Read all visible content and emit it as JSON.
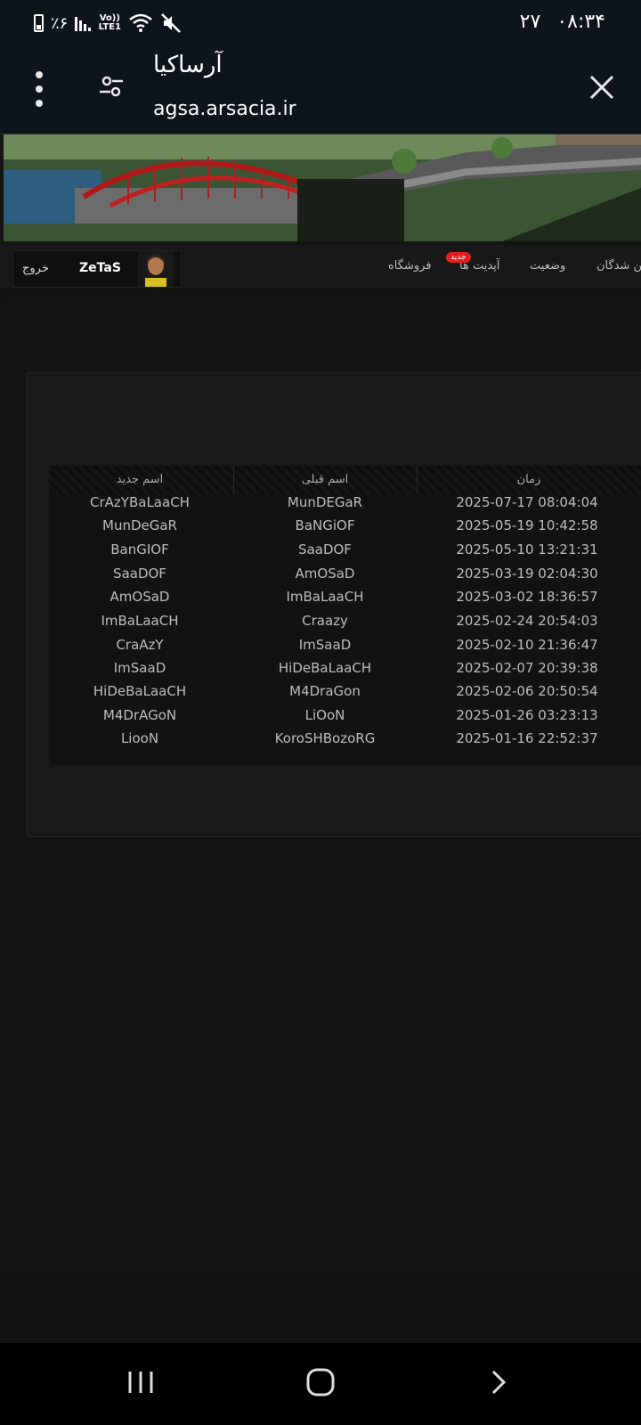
{
  "status_bar": {
    "battery_text": "٪۶",
    "network": "Vo)) LTE1",
    "date": "۲۷",
    "time": "۰۸:۳۴"
  },
  "app_bar": {
    "title": "آرساکیا",
    "url": "agsa.arsacia.ir"
  },
  "nav": {
    "logout": "خروج",
    "username": "ZeTaS",
    "links": [
      "فروشگاه",
      "آپدیت ها",
      "وضعیت",
      "ین شدگان"
    ],
    "new_badge": "جدید"
  },
  "table": {
    "headers": {
      "new_name": "اسم جدید",
      "old_name": "اسم قبلی",
      "time": "زمان"
    },
    "rows": [
      {
        "new": "CrAzYBaLaaCH",
        "old": "MunDEGaR",
        "time": "2025-07-17 08:04:04"
      },
      {
        "new": "MunDeGaR",
        "old": "BaNGiOF",
        "time": "2025-05-19 10:42:58"
      },
      {
        "new": "BanGIOF",
        "old": "SaaDOF",
        "time": "2025-05-10 13:21:31"
      },
      {
        "new": "SaaDOF",
        "old": "AmOSaD",
        "time": "2025-03-19 02:04:30"
      },
      {
        "new": "AmOSaD",
        "old": "ImBaLaaCH",
        "time": "2025-03-02 18:36:57"
      },
      {
        "new": "ImBaLaaCH",
        "old": "Craazy",
        "time": "2025-02-24 20:54:03"
      },
      {
        "new": "CraAzY",
        "old": "ImSaaD",
        "time": "2025-02-10 21:36:47"
      },
      {
        "new": "ImSaaD",
        "old": "HiDeBaLaaCH",
        "time": "2025-02-07 20:39:38"
      },
      {
        "new": "HiDeBaLaaCH",
        "old": "M4DraGon",
        "time": "2025-02-06 20:50:54"
      },
      {
        "new": "M4DrAGoN",
        "old": "LiOoN",
        "time": "2025-01-26 03:23:13"
      },
      {
        "new": "LiooN",
        "old": "KoroSHBozoRG",
        "time": "2025-01-16 22:52:37"
      }
    ]
  }
}
